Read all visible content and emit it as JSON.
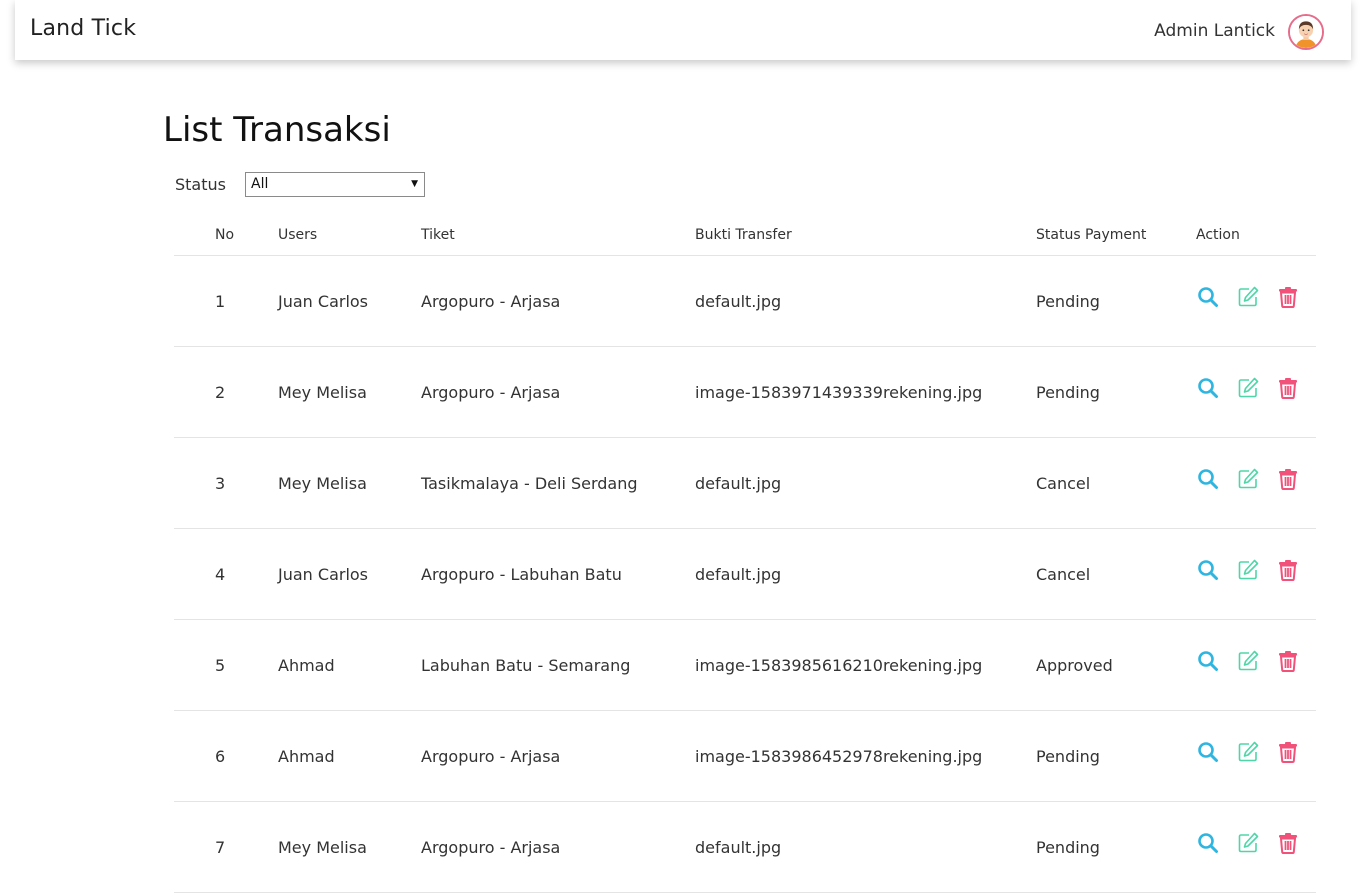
{
  "navbar": {
    "brand": "Land Tick",
    "admin_name": "Admin Lantick",
    "avatar_icon": "user-avatar-icon"
  },
  "page": {
    "title": "List Transaksi"
  },
  "filter": {
    "label": "Status",
    "selected": "All"
  },
  "table": {
    "headers": {
      "no": "No",
      "users": "Users",
      "tiket": "Tiket",
      "bukti": "Bukti Transfer",
      "status": "Status Payment",
      "action": "Action"
    },
    "rows": [
      {
        "no": "1",
        "user": "Juan Carlos",
        "tiket": "Argopuro - Arjasa",
        "bukti": "default.jpg",
        "status": "Pending"
      },
      {
        "no": "2",
        "user": "Mey Melisa",
        "tiket": "Argopuro - Arjasa",
        "bukti": "image-1583971439339rekening.jpg",
        "status": "Pending"
      },
      {
        "no": "3",
        "user": "Mey Melisa",
        "tiket": "Tasikmalaya - Deli Serdang",
        "bukti": "default.jpg",
        "status": "Cancel"
      },
      {
        "no": "4",
        "user": "Juan Carlos",
        "tiket": "Argopuro - Labuhan Batu",
        "bukti": "default.jpg",
        "status": "Cancel"
      },
      {
        "no": "5",
        "user": "Ahmad",
        "tiket": "Labuhan Batu - Semarang",
        "bukti": "image-1583985616210rekening.jpg",
        "status": "Approved"
      },
      {
        "no": "6",
        "user": "Ahmad",
        "tiket": "Argopuro - Arjasa",
        "bukti": "image-1583986452978rekening.jpg",
        "status": "Pending"
      },
      {
        "no": "7",
        "user": "Mey Melisa",
        "tiket": "Argopuro - Arjasa",
        "bukti": "default.jpg",
        "status": "Pending"
      }
    ]
  },
  "icons": {
    "view": "search-icon",
    "edit": "edit-icon",
    "delete": "trash-icon"
  },
  "colors": {
    "view": "#2fb6e0",
    "edit": "#4fd6a8",
    "delete": "#f2527a",
    "avatar_border": "#e86b8a"
  }
}
